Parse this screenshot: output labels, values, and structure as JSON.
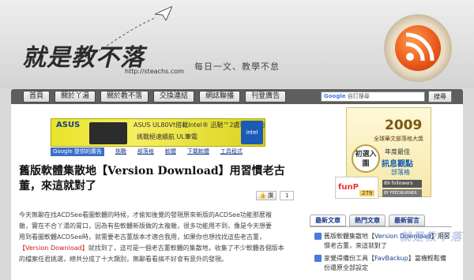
{
  "header": {
    "title": "就是教不落",
    "url": "http://steachs.com",
    "slogan": "每日一文、教學不怠"
  },
  "nav": {
    "items": [
      "首頁",
      "關於丫湯",
      "關於教不落",
      "交換連結",
      "網誌聯播",
      "刊登廣告"
    ],
    "search_placeholder": "自訂搜尋",
    "search_brand": "Google",
    "search_button": "搜尋"
  },
  "ad_banner": {
    "brand": "ASUS",
    "line1": "ASUS UL80Vt搭載Intel® 迅馳™2處理器技術",
    "line2": "挑戰極速續航  UL筆電",
    "intel": "intel",
    "google_label": "Google 提供的廣告",
    "links": [
      "挑戰",
      "部落格",
      "軟體",
      "下載軟體",
      "工具程式"
    ]
  },
  "post": {
    "title": "舊版軟體集散地【Version Download】用習慣老古董，來這就對了",
    "like_label": "讚",
    "like_count": "1",
    "body_line1": "今天無聊在找ACDSee看圖軟體的時候，才偷知後覺的發現原來新版的ACDSee功能那麼複",
    "body_line2": "雜，實在不合丫湯的胃口，因為有些軟體新版做的太複雜，很多功能用不到，像是今天想要",
    "body_line3": "用到看圖軟體ACDSee時，就需要老古董版本才適合我用，如果你也想找找這些老古董，",
    "body_keyword": "【Version Download】",
    "body_line4": "就找到了，這可是一個老古董軟體的集散地，收集了不少軟體各個版本",
    "body_line5": "的檔案任君挑選，總共分成了十大類別，無聊看看搞不好會有意外的發現。"
  },
  "sidebar": {
    "ad_year": "2009",
    "ad_sub": "全球華文部落格大獎",
    "ad_circle": "初選入圍",
    "ad_msg": "年度最佳",
    "ad_msg2": "訊息觀點",
    "ad_msg3": "部落格",
    "funp": "funP",
    "funp_count": "279",
    "ff_count": "89 followers",
    "ff_label": "BY FEEDBURNER",
    "tabs": [
      "最新文章",
      "熱門文章",
      "最新留言"
    ],
    "items": [
      {
        "before": "舊版軟體集散地【",
        "kw": "Version Download",
        "after": "】用習慣老古董，來這就對了"
      },
      {
        "before": "家覺得備份工具【",
        "kw": "FavBackup",
        "after": "】當機輕鬆備份還原全部設定"
      }
    ],
    "watermark": "就是教不落"
  }
}
